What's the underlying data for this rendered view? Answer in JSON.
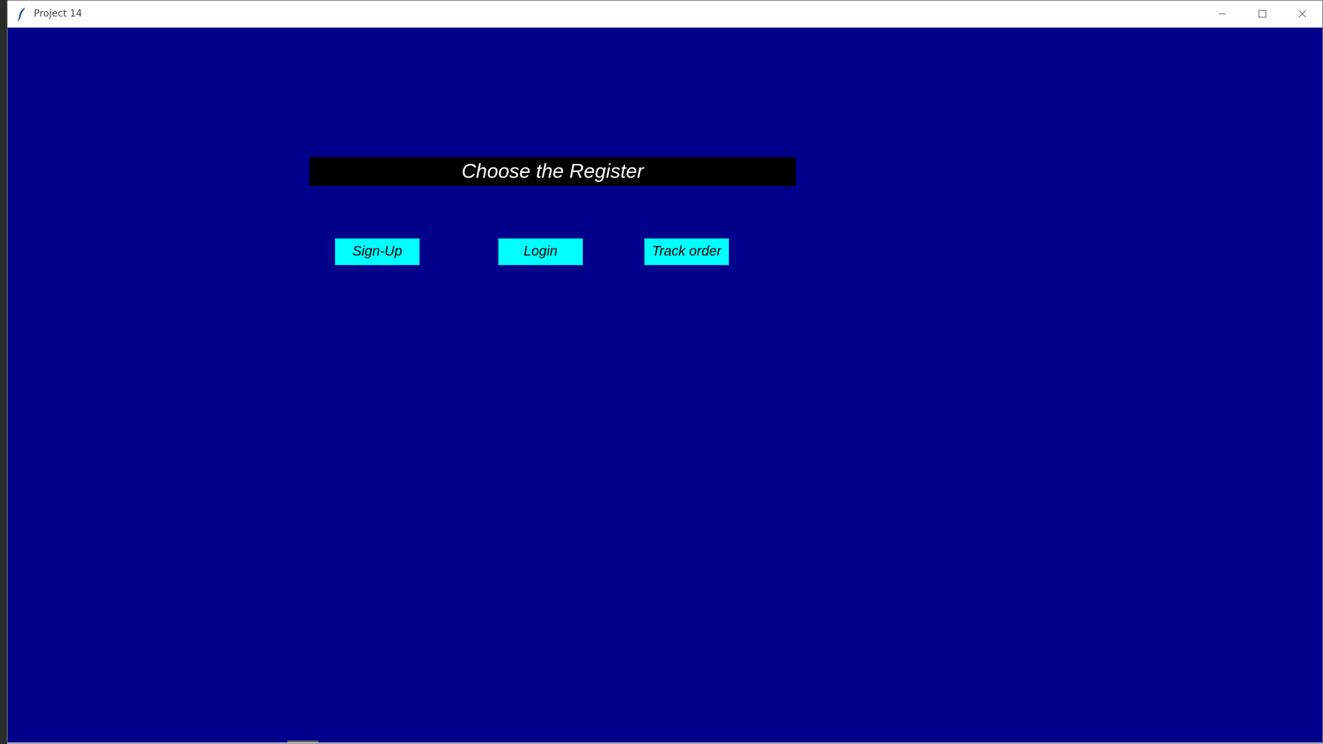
{
  "window": {
    "title": "Project 14",
    "icon": "feather-icon"
  },
  "main": {
    "heading": "Choose the Register",
    "buttons": [
      {
        "label": "Sign-Up"
      },
      {
        "label": "Login"
      },
      {
        "label": "Track order"
      }
    ]
  },
  "colors": {
    "background": "#00008b",
    "heading_bg": "#000000",
    "heading_text": "#ffffff",
    "button_bg": "#00ffff"
  }
}
